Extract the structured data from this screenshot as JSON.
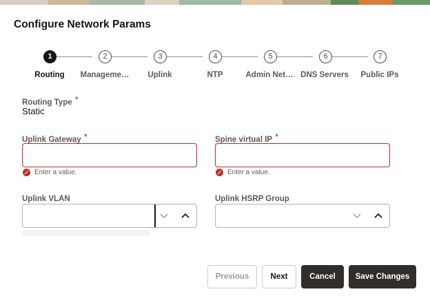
{
  "dialog": {
    "title": "Configure Network Params"
  },
  "stepper": {
    "steps": [
      {
        "number": "1",
        "label": "Routing",
        "active": true
      },
      {
        "number": "2",
        "label": "Manageme…",
        "active": false
      },
      {
        "number": "3",
        "label": "Uplink",
        "active": false
      },
      {
        "number": "4",
        "label": "NTP",
        "active": false
      },
      {
        "number": "5",
        "label": "Admin Net…",
        "active": false
      },
      {
        "number": "6",
        "label": "DNS Servers",
        "active": false
      },
      {
        "number": "7",
        "label": "Public IPs",
        "active": false
      }
    ]
  },
  "form": {
    "routing_type": {
      "label": "Routing Type",
      "required": "*",
      "value": "Static"
    },
    "uplink_gateway": {
      "label": "Uplink Gateway",
      "required": "*",
      "value": "",
      "error": "Enter a value."
    },
    "spine_virtual_ip": {
      "label": "Spine virtual IP",
      "required": "*",
      "value": "",
      "error": "Enter a value."
    },
    "uplink_vlan": {
      "label": "Uplink VLAN",
      "value": ""
    },
    "uplink_hsrp_group": {
      "label": "Uplink HSRP Group",
      "value": ""
    }
  },
  "buttons": {
    "previous": "Previous",
    "next": "Next",
    "cancel": "Cancel",
    "save": "Save Changes"
  },
  "colors": {
    "error": "#b1302f",
    "primary_button": "#312d2a",
    "active_step": "#161513"
  }
}
